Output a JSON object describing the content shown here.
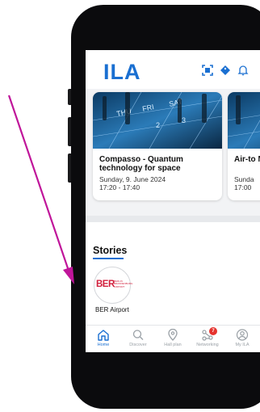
{
  "app": {
    "logo_text": "ILA"
  },
  "header": {
    "icons": [
      "qr-scan-icon",
      "tag-icon",
      "bell-icon"
    ],
    "accent_color": "#1a6fd1"
  },
  "events": [
    {
      "title": "Compasso - Quantum technology for space",
      "date": "Sunday, 9. June 2024",
      "time": "17:20 - 17:40",
      "image": "calendar-photo"
    },
    {
      "title": "Air-to MRTT",
      "date": "Sunda",
      "time": "17:00",
      "image": "calendar-photo"
    }
  ],
  "stories": {
    "title": "Stories",
    "items": [
      {
        "logo_text": "BER",
        "logo_subtext": "BERLIN BRANDENBURG AIRPORT",
        "label": "BER Airport"
      }
    ]
  },
  "tabbar": {
    "items": [
      {
        "label": "Home",
        "icon": "home-icon",
        "active": true
      },
      {
        "label": "Discover",
        "icon": "search-icon",
        "active": false
      },
      {
        "label": "Hall plan",
        "icon": "location-pin-icon",
        "active": false
      },
      {
        "label": "Networking",
        "icon": "network-icon",
        "active": false,
        "badge": "7"
      },
      {
        "label": "My ILA",
        "icon": "user-icon",
        "active": false
      }
    ]
  },
  "annotation": {
    "arrow_color": "#c0159a"
  }
}
